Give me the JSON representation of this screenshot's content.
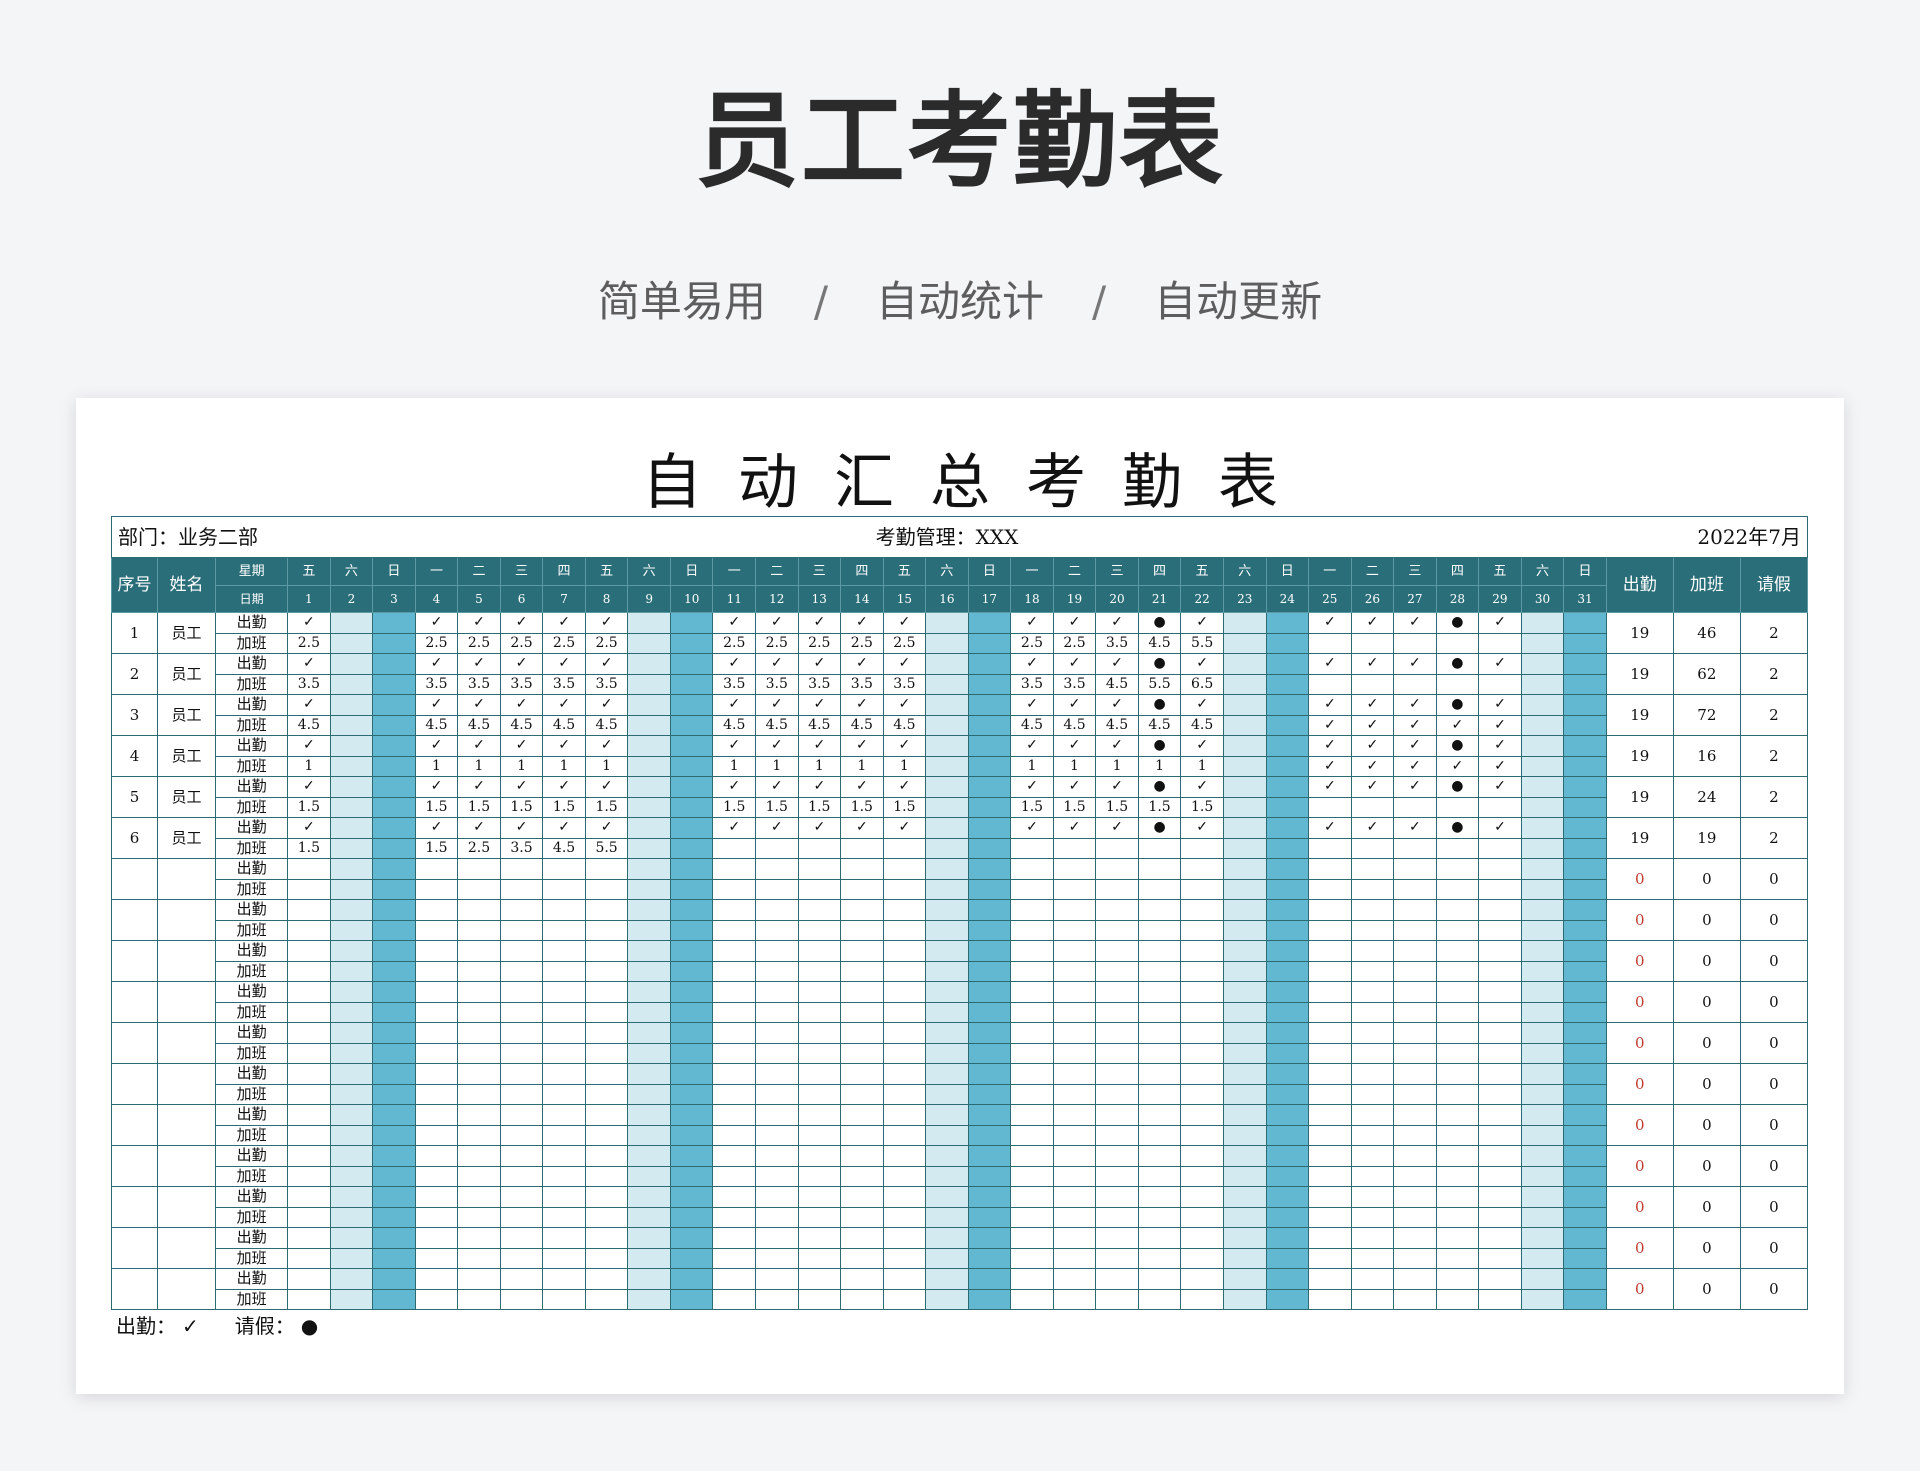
{
  "hero": {
    "title": "员工考勤表",
    "features": [
      "简单易用",
      "自动统计",
      "自动更新"
    ],
    "separator": "/"
  },
  "sheet": {
    "title": "自动汇总考勤表",
    "department": "部门：业务二部",
    "manager": "考勤管理：XXX",
    "period": "2022年7月",
    "header": {
      "index": "序号",
      "name": "姓名",
      "weekday_label": "星期",
      "date_label": "日期",
      "attend": "出勤",
      "overtime": "加班",
      "leave": "请假"
    },
    "weekdays": [
      "五",
      "六",
      "日",
      "一",
      "二",
      "三",
      "四",
      "五",
      "六",
      "日",
      "一",
      "二",
      "三",
      "四",
      "五",
      "六",
      "日",
      "一",
      "二",
      "三",
      "四",
      "五",
      "六",
      "日",
      "一",
      "二",
      "三",
      "四",
      "五",
      "六",
      "日"
    ],
    "row_labels": {
      "attend": "出勤",
      "overtime": "加班"
    },
    "employees": [
      {
        "index": "1",
        "name": "员工",
        "attend": [
          "✓",
          "",
          "",
          "✓",
          "✓",
          "✓",
          "✓",
          "✓",
          "",
          "",
          "✓",
          "✓",
          "✓",
          "✓",
          "✓",
          "",
          "",
          "✓",
          "✓",
          "✓",
          "●",
          "✓",
          "",
          "",
          "✓",
          "✓",
          "✓",
          "●",
          "✓",
          "",
          ""
        ],
        "overtime": [
          "2.5",
          "",
          "",
          "2.5",
          "2.5",
          "2.5",
          "2.5",
          "2.5",
          "",
          "",
          "2.5",
          "2.5",
          "2.5",
          "2.5",
          "2.5",
          "",
          "",
          "2.5",
          "2.5",
          "3.5",
          "4.5",
          "5.5",
          "",
          "",
          "",
          "",
          "",
          "",
          "",
          "",
          ""
        ],
        "total_attend": "19",
        "total_overtime": "46",
        "total_leave": "2"
      },
      {
        "index": "2",
        "name": "员工",
        "attend": [
          "✓",
          "",
          "",
          "✓",
          "✓",
          "✓",
          "✓",
          "✓",
          "",
          "",
          "✓",
          "✓",
          "✓",
          "✓",
          "✓",
          "",
          "",
          "✓",
          "✓",
          "✓",
          "●",
          "✓",
          "",
          "",
          "✓",
          "✓",
          "✓",
          "●",
          "✓",
          "",
          ""
        ],
        "overtime": [
          "3.5",
          "",
          "",
          "3.5",
          "3.5",
          "3.5",
          "3.5",
          "3.5",
          "",
          "",
          "3.5",
          "3.5",
          "3.5",
          "3.5",
          "3.5",
          "",
          "",
          "3.5",
          "3.5",
          "4.5",
          "5.5",
          "6.5",
          "",
          "",
          "",
          "",
          "",
          "",
          "",
          "",
          ""
        ],
        "total_attend": "19",
        "total_overtime": "62",
        "total_leave": "2"
      },
      {
        "index": "3",
        "name": "员工",
        "attend": [
          "✓",
          "",
          "",
          "✓",
          "✓",
          "✓",
          "✓",
          "✓",
          "",
          "",
          "✓",
          "✓",
          "✓",
          "✓",
          "✓",
          "",
          "",
          "✓",
          "✓",
          "✓",
          "●",
          "✓",
          "",
          "",
          "✓",
          "✓",
          "✓",
          "●",
          "✓",
          "",
          ""
        ],
        "overtime": [
          "4.5",
          "",
          "",
          "4.5",
          "4.5",
          "4.5",
          "4.5",
          "4.5",
          "",
          "",
          "4.5",
          "4.5",
          "4.5",
          "4.5",
          "4.5",
          "",
          "",
          "4.5",
          "4.5",
          "4.5",
          "4.5",
          "4.5",
          "",
          "",
          "✓",
          "✓",
          "✓",
          "✓",
          "✓",
          "",
          ""
        ],
        "total_attend": "19",
        "total_overtime": "72",
        "total_leave": "2"
      },
      {
        "index": "4",
        "name": "员工",
        "attend": [
          "✓",
          "",
          "",
          "✓",
          "✓",
          "✓",
          "✓",
          "✓",
          "",
          "",
          "✓",
          "✓",
          "✓",
          "✓",
          "✓",
          "",
          "",
          "✓",
          "✓",
          "✓",
          "●",
          "✓",
          "",
          "",
          "✓",
          "✓",
          "✓",
          "●",
          "✓",
          "",
          ""
        ],
        "overtime": [
          "1",
          "",
          "",
          "1",
          "1",
          "1",
          "1",
          "1",
          "",
          "",
          "1",
          "1",
          "1",
          "1",
          "1",
          "",
          "",
          "1",
          "1",
          "1",
          "1",
          "1",
          "",
          "",
          "✓",
          "✓",
          "✓",
          "✓",
          "✓",
          "",
          ""
        ],
        "total_attend": "19",
        "total_overtime": "16",
        "total_leave": "2"
      },
      {
        "index": "5",
        "name": "员工",
        "attend": [
          "✓",
          "",
          "",
          "✓",
          "✓",
          "✓",
          "✓",
          "✓",
          "",
          "",
          "✓",
          "✓",
          "✓",
          "✓",
          "✓",
          "",
          "",
          "✓",
          "✓",
          "✓",
          "●",
          "✓",
          "",
          "",
          "✓",
          "✓",
          "✓",
          "●",
          "✓",
          "",
          ""
        ],
        "overtime": [
          "1.5",
          "",
          "",
          "1.5",
          "1.5",
          "1.5",
          "1.5",
          "1.5",
          "",
          "",
          "1.5",
          "1.5",
          "1.5",
          "1.5",
          "1.5",
          "",
          "",
          "1.5",
          "1.5",
          "1.5",
          "1.5",
          "1.5",
          "",
          "",
          "",
          "",
          "",
          "",
          "",
          "",
          ""
        ],
        "total_attend": "19",
        "total_overtime": "24",
        "total_leave": "2"
      },
      {
        "index": "6",
        "name": "员工",
        "attend": [
          "✓",
          "",
          "",
          "✓",
          "✓",
          "✓",
          "✓",
          "✓",
          "",
          "",
          "✓",
          "✓",
          "✓",
          "✓",
          "✓",
          "",
          "",
          "✓",
          "✓",
          "✓",
          "●",
          "✓",
          "",
          "",
          "✓",
          "✓",
          "✓",
          "●",
          "✓",
          "",
          ""
        ],
        "overtime": [
          "1.5",
          "",
          "",
          "1.5",
          "2.5",
          "3.5",
          "4.5",
          "5.5",
          "",
          "",
          "",
          "",
          "",
          "",
          "",
          "",
          "",
          "",
          "",
          "",
          "",
          "",
          "",
          "",
          "",
          "",
          "",
          "",
          "",
          "",
          ""
        ],
        "total_attend": "19",
        "total_overtime": "19",
        "total_leave": "2"
      }
    ],
    "empty_rows": 11,
    "empty_totals": {
      "attend": "0",
      "overtime": "0",
      "leave": "0"
    },
    "legend": {
      "attend_label": "出勤：",
      "attend_symbol": "✓",
      "leave_label": "请假：",
      "leave_symbol": "●"
    },
    "colors": {
      "header": "#2a6e79",
      "sunday": "#62b8d0",
      "saturday": "#d3ebf0",
      "zero": "#c23b2e"
    }
  }
}
